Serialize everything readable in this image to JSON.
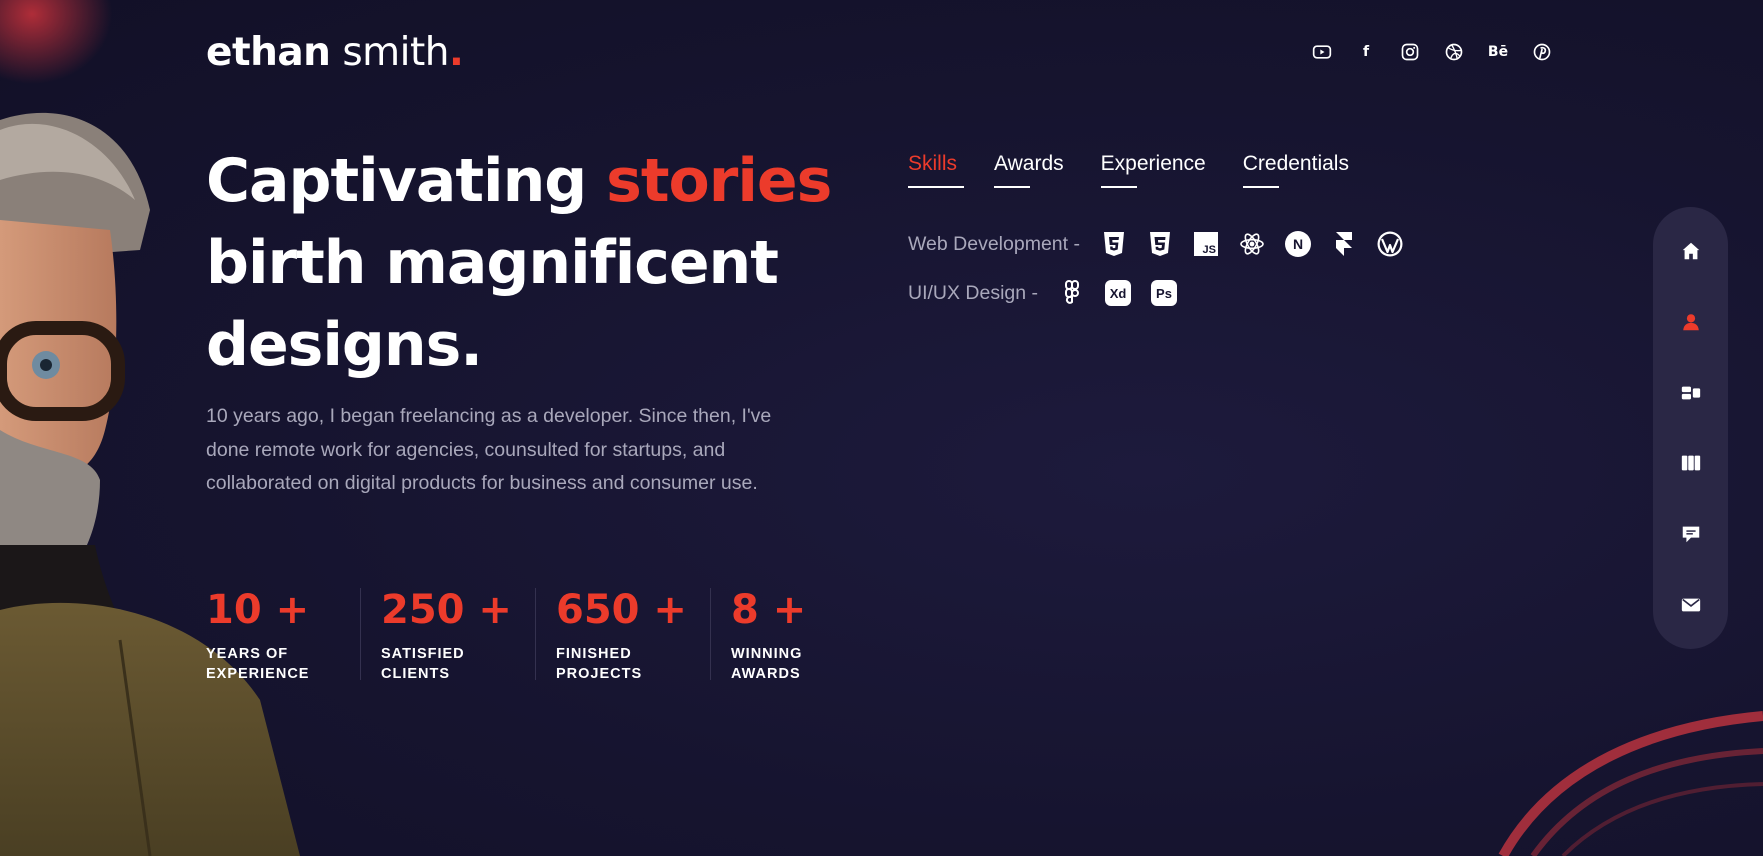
{
  "brand": {
    "first": "ethan",
    "last": " smith",
    "dot": "."
  },
  "social": [
    {
      "name": "youtube-icon"
    },
    {
      "name": "facebook-icon",
      "glyph": "f"
    },
    {
      "name": "instagram-icon"
    },
    {
      "name": "dribbble-icon"
    },
    {
      "name": "behance-icon",
      "glyph": "Bē"
    },
    {
      "name": "pinterest-icon"
    }
  ],
  "hero": {
    "headline_part1": "Captivating ",
    "headline_highlight": "stories",
    "headline_line2": "birth magnificent",
    "headline_line3": "designs.",
    "intro": "10 years ago, I began freelancing as a developer. Since then, I've done remote work for agencies, counsulted for startups, and collaborated on digital products for business and consumer use."
  },
  "stats": [
    {
      "value": "10 +",
      "label": "YEARS OF EXPERIENCE"
    },
    {
      "value": "250 +",
      "label": "SATISFIED CLIENTS"
    },
    {
      "value": "650 +",
      "label": "FINISHED PROJECTS"
    },
    {
      "value": "8 +",
      "label": "WINNING AWARDS"
    }
  ],
  "tabs": [
    {
      "label": "Skills",
      "active": true
    },
    {
      "label": "Awards",
      "active": false
    },
    {
      "label": "Experience",
      "active": false
    },
    {
      "label": "Credentials",
      "active": false
    }
  ],
  "skills": {
    "web_label": "Web Development  -",
    "web_icons": [
      "html5-icon",
      "css3-icon",
      "javascript-icon",
      "react-icon",
      "nextjs-icon",
      "framer-icon",
      "wordpress-icon"
    ],
    "js_text": "JS",
    "next_text": "N",
    "ui_label": "UI/UX Design  -",
    "ui_icons": [
      "figma-icon",
      "adobe-xd-icon",
      "photoshop-icon"
    ],
    "xd_text": "Xd",
    "ps_text": "Ps"
  },
  "sidenav": [
    "home-icon",
    "user-icon",
    "projects-icon",
    "portfolio-icon",
    "chat-icon",
    "mail-icon"
  ],
  "colors": {
    "accent": "#ec3b2b",
    "background": "#16142f",
    "muted": "#a9a8bb",
    "nav_bg": "#2a2745"
  }
}
